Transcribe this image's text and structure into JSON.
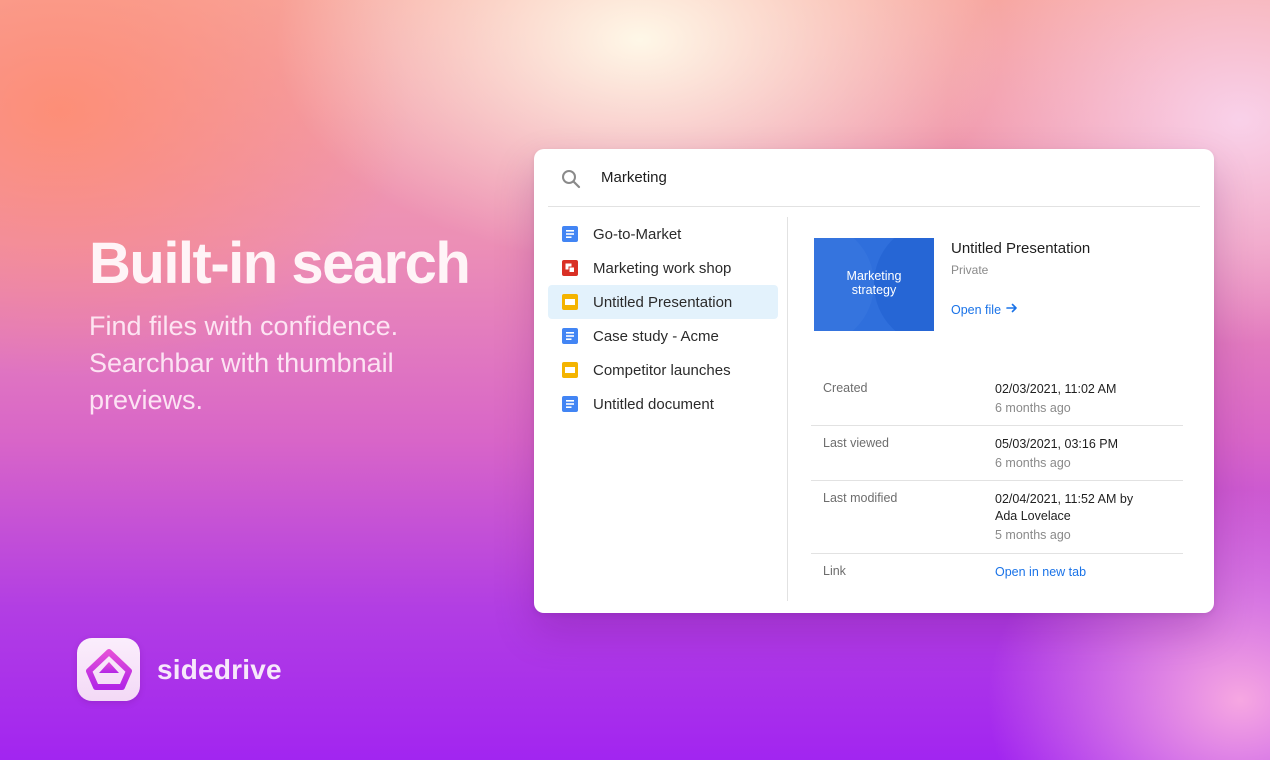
{
  "hero": {
    "title": "Built-in search",
    "subtitle_lines": [
      "Find files with confidence.",
      "Searchbar with thumbnail",
      "previews."
    ]
  },
  "brand": {
    "name": "sidedrive",
    "logo_icon": "sidedrive-logo-icon"
  },
  "search": {
    "query": "Marketing",
    "icon": "search-icon"
  },
  "files": [
    {
      "label": "Go-to-Market",
      "type": "doc",
      "icon": "docs-icon",
      "color": "#4285f4"
    },
    {
      "label": "Marketing work shop",
      "type": "other",
      "icon": "red-file-icon",
      "color": "#d93025"
    },
    {
      "label": "Untitled Presentation",
      "type": "slides",
      "icon": "slides-icon",
      "color": "#f4b400",
      "selected": true
    },
    {
      "label": "Case study - Acme",
      "type": "doc",
      "icon": "docs-icon",
      "color": "#4285f4"
    },
    {
      "label": "Competitor launches",
      "type": "slides",
      "icon": "slides-icon",
      "color": "#f4b400"
    },
    {
      "label": "Untitled document",
      "type": "doc",
      "icon": "docs-icon",
      "color": "#4285f4"
    }
  ],
  "preview": {
    "thumbnail_text": [
      "Marketing",
      "strategy"
    ],
    "title": "Untitled Presentation",
    "visibility": "Private",
    "open_label": "Open file",
    "open_icon": "arrow-right-icon",
    "meta": {
      "created_label": "Created",
      "created_value": "02/03/2021, 11:02 AM",
      "created_ago": "6 months ago",
      "viewed_label": "Last viewed",
      "viewed_value": "05/03/2021, 03:16 PM",
      "viewed_ago": "6 months ago",
      "modified_label": "Last modified",
      "modified_value_1": "02/04/2021, 11:52 AM by",
      "modified_value_2": "Ada Lovelace",
      "modified_ago": "5 months ago",
      "link_label": "Link",
      "link_value": "Open in new tab"
    }
  },
  "colors": {
    "accent": "#1a73e8",
    "selected_bg": "#e3f2fc",
    "thumb_bg": "#2f6fdc"
  }
}
